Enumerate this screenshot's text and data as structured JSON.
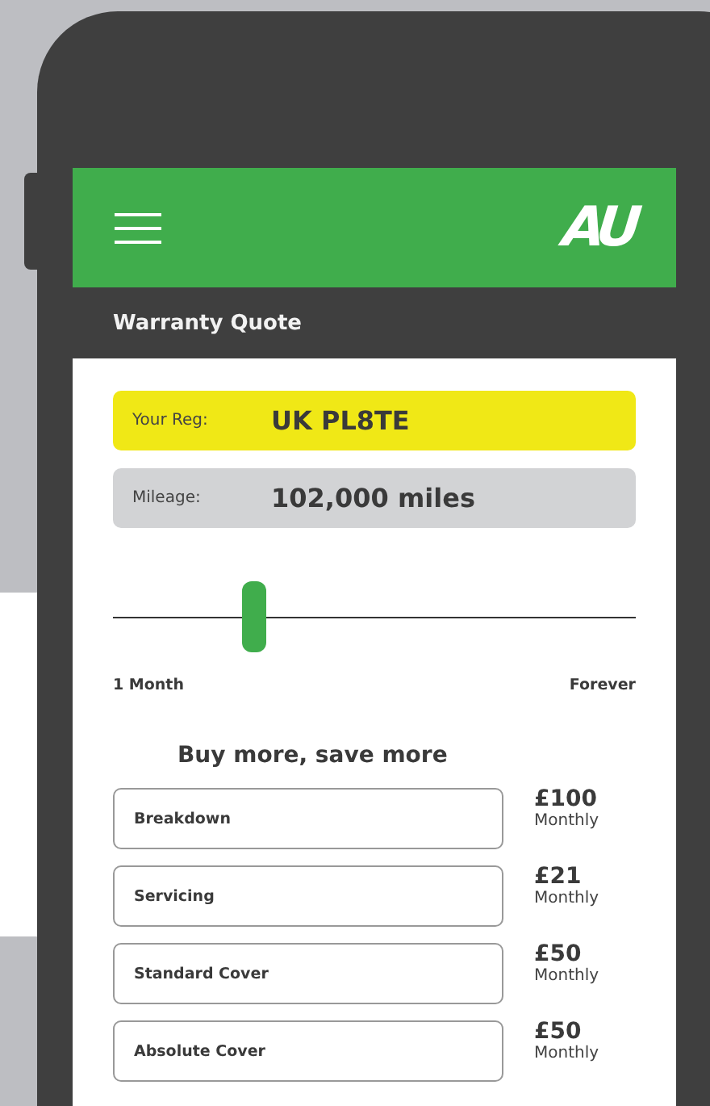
{
  "header": {
    "logo": "AU"
  },
  "page_title": "Warranty Quote",
  "registration": {
    "label": "Your Reg:",
    "value": "UK PL8TE"
  },
  "mileage": {
    "label": "Mileage:",
    "value": "102,000 miles"
  },
  "duration_slider": {
    "level": 0.27,
    "min_label": "1 Month",
    "max_label": "Forever"
  },
  "section_title": "Buy more, save more",
  "products": [
    {
      "name": "Breakdown",
      "price": "£100",
      "period": "Monthly"
    },
    {
      "name": "Servicing",
      "price": "£21",
      "period": "Monthly"
    },
    {
      "name": "Standard Cover",
      "price": "£50",
      "period": "Monthly"
    },
    {
      "name": "Absolute Cover",
      "price": "£50",
      "period": "Monthly"
    }
  ]
}
